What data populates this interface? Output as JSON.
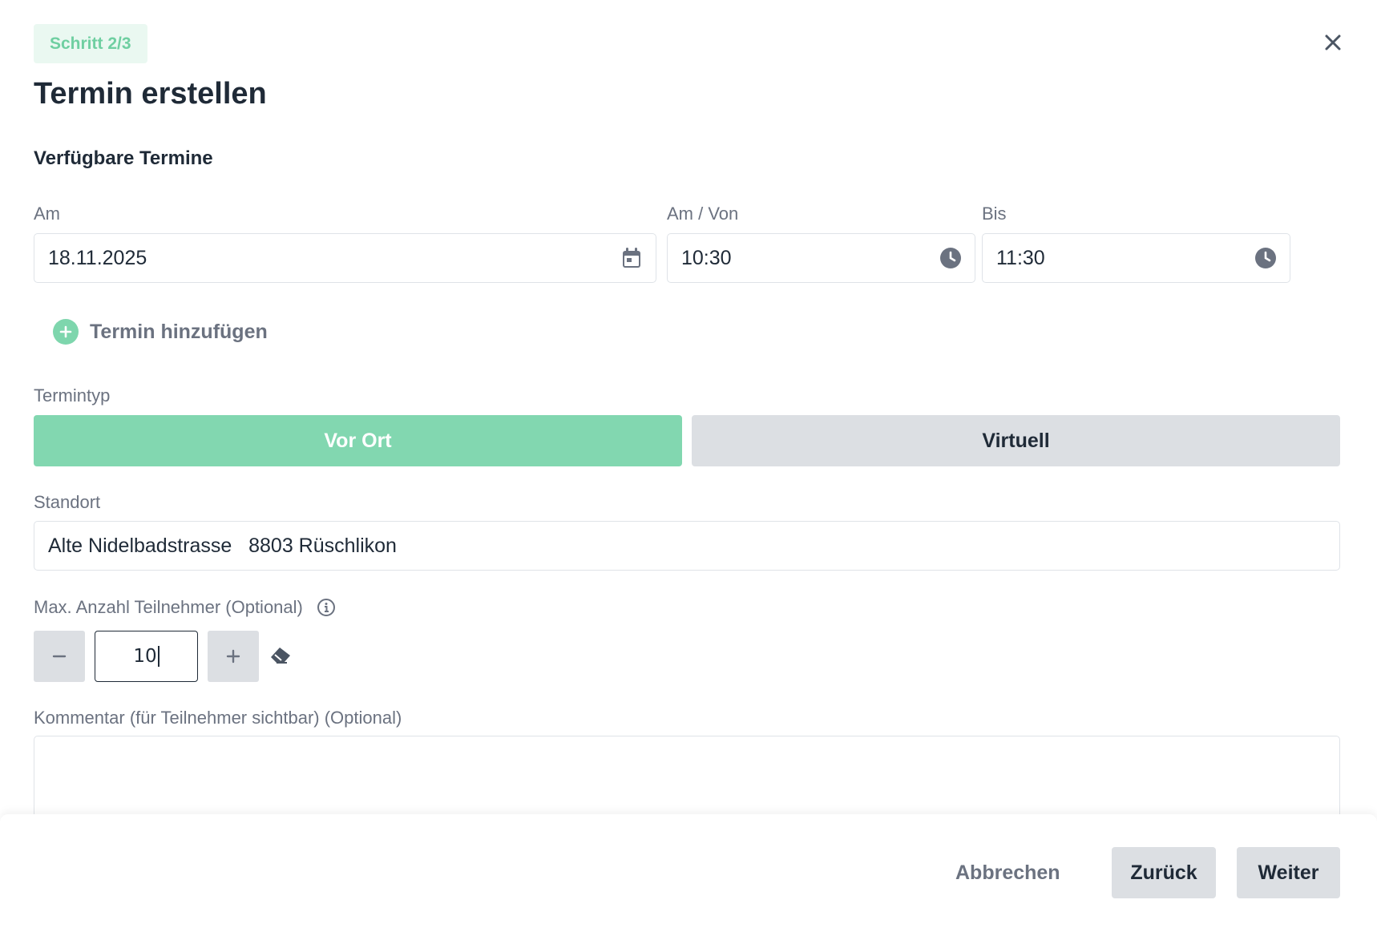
{
  "header": {
    "step": "Schritt 2/3",
    "title": "Termin erstellen"
  },
  "available": {
    "section_title": "Verfügbare Termine",
    "date_label": "Am",
    "date_value": "18.11.2025",
    "from_label": "Am / Von",
    "from_value": "10:30",
    "to_label": "Bis",
    "to_value": "11:30",
    "add_label": "Termin hinzufügen"
  },
  "type": {
    "label": "Termintyp",
    "options": [
      "Vor Ort",
      "Virtuell"
    ],
    "selected": "Vor Ort"
  },
  "location": {
    "label": "Standort",
    "value": "Alte Nidelbadstrasse   8803 Rüschlikon"
  },
  "participants": {
    "label": "Max. Anzahl Teilnehmer (Optional)",
    "value": "10"
  },
  "comment": {
    "label": "Kommentar (für Teilnehmer sichtbar) (Optional)",
    "value": ""
  },
  "footer": {
    "cancel": "Abbrechen",
    "back": "Zurück",
    "next": "Weiter"
  },
  "colors": {
    "accent": "#82d7b0",
    "badge_bg": "#eaf8f1",
    "text": "#1f2a37",
    "muted": "#6b7280",
    "button_gray": "#dcdfe3"
  },
  "icons": {
    "close": "close-icon",
    "date": "calendar-icon",
    "time": "clock-icon",
    "add": "plus-circle-icon",
    "info": "info-icon",
    "minus": "minus-icon",
    "plus": "plus-icon",
    "clear": "eraser-icon"
  }
}
